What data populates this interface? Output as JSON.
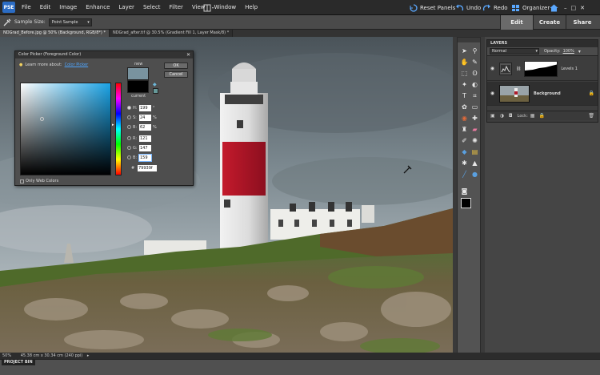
{
  "app": {
    "logo_text": "PSE"
  },
  "menubar": {
    "items": [
      "File",
      "Edit",
      "Image",
      "Enhance",
      "Layer",
      "Select",
      "Filter",
      "View",
      "Window",
      "Help"
    ],
    "reset_panels": "Reset Panels",
    "undo": "Undo",
    "redo": "Redo",
    "organizer": "Organizer"
  },
  "mode_tabs": [
    "Edit",
    "Create",
    "Share"
  ],
  "options_bar": {
    "sample_size_label": "Sample Size:",
    "sample_size_value": "Point Sample"
  },
  "doc_tabs": [
    "NDGrad_Before.jpg @ 50% (Background, RGB/8*) *",
    "NDGrad_after.tif @ 30.5% (Gradient Fill 1, Layer Mask/8) *"
  ],
  "color_picker": {
    "title": "Color Picker (Foreground Color)",
    "learn_more": "Learn more about:",
    "learn_link": "Color Picker",
    "new_label": "new",
    "current_label": "current",
    "ok": "OK",
    "cancel": "Cancel",
    "fields": [
      {
        "label": "H:",
        "value": "199",
        "unit": "°",
        "selected": true
      },
      {
        "label": "S:",
        "value": "24",
        "unit": "%",
        "selected": false
      },
      {
        "label": "B:",
        "value": "62",
        "unit": "%",
        "selected": false
      },
      {
        "label": "R:",
        "value": "121",
        "unit": "",
        "selected": false
      },
      {
        "label": "G:",
        "value": "147",
        "unit": "",
        "selected": false
      },
      {
        "label": "B:",
        "value": "159",
        "unit": "",
        "selected": false
      }
    ],
    "hex_label": "#",
    "hex_value": "79939f",
    "web_colors_label": "Only Web Colors",
    "new_color": "#79939f",
    "current_color": "#000000"
  },
  "layers_panel": {
    "title": "LAYERS",
    "blend_mode": "Normal",
    "opacity_label": "Opacity:",
    "opacity_value": "100%",
    "lock_label": "Lock:",
    "layers": [
      {
        "name": "Levels 1",
        "selected": false
      },
      {
        "name": "Background",
        "selected": true
      }
    ]
  },
  "status": {
    "zoom": "50%",
    "doc_size": "45.38 cm x 30.34 cm (240 ppi)"
  },
  "project_bin": {
    "label": "PROJECT BIN"
  }
}
